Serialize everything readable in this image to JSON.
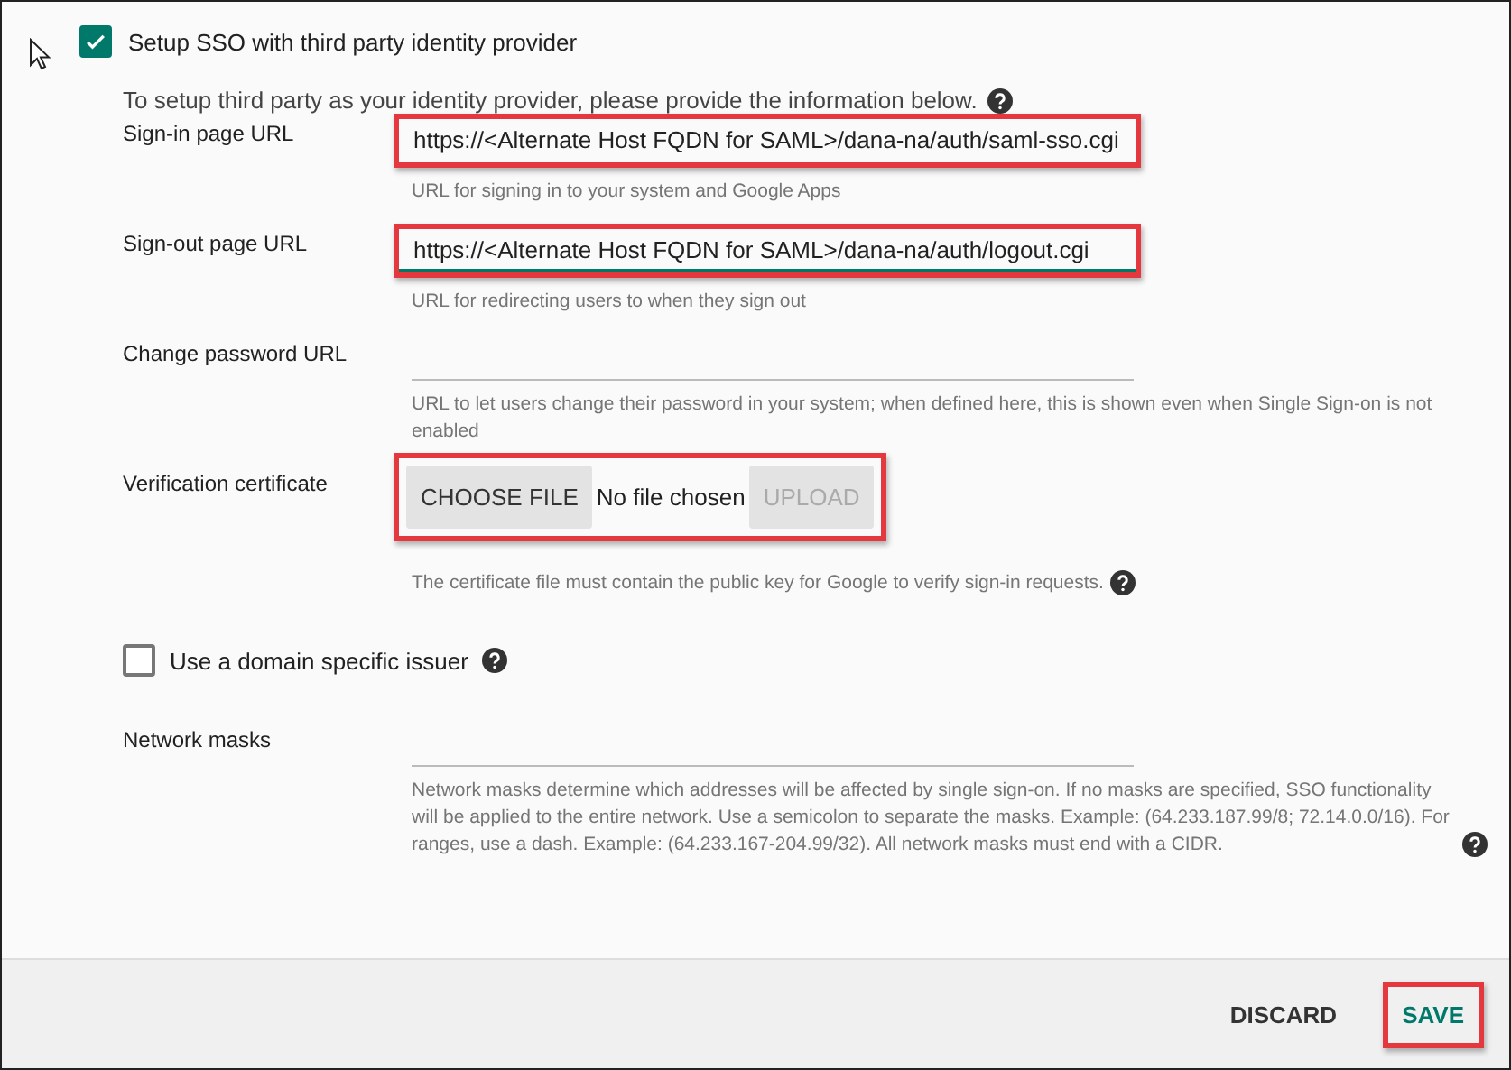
{
  "sso": {
    "label": "Setup SSO with third party identity provider",
    "checked": true
  },
  "intro": {
    "text": "To setup third party as your identity provider, please provide the information below.",
    "help": true
  },
  "rows": [
    {
      "kind": "text",
      "label": "Sign-in page URL",
      "value": "https://<Alternate Host FQDN for SAML>/dana-na/auth/saml-sso.cgi",
      "hint": "URL for signing in to your system and Google Apps",
      "highlighted": true,
      "focused": false
    },
    {
      "kind": "text",
      "label": "Sign-out page URL",
      "value": "https://<Alternate Host FQDN for SAML>/dana-na/auth/logout.cgi",
      "hint": "URL for redirecting users to when they sign out",
      "highlighted": true,
      "focused": true
    },
    {
      "kind": "text",
      "label": "Change password URL",
      "hint": "URL to let users change their password in your system; when defined here, this is shown even when Single Sign-on is not enabled",
      "highlighted": false,
      "focused": false
    },
    {
      "kind": "file",
      "label": "Verification certificate",
      "choose": "CHOOSE FILE",
      "status": "No file chosen",
      "upload": "UPLOAD",
      "upload_disabled": true,
      "hint": "The certificate file must contain the public key for Google to verify sign-in requests.",
      "highlighted": true,
      "help": true
    },
    {
      "kind": "checkbox",
      "label": "Use a domain specific issuer",
      "checked": false,
      "help": true
    },
    {
      "kind": "text",
      "label": "Network masks",
      "hint": "Network masks determine which addresses will be affected by single sign-on. If no masks are specified, SSO functionality will be applied to the entire network. Use a semicolon to separate the masks. Example: (64.233.187.99/8; 72.14.0.0/16). For ranges, use a dash. Example: (64.233.167-204.99/32). All network masks must end with a CIDR.",
      "highlighted": false,
      "focused": false,
      "help": true
    }
  ],
  "buttons": [
    {
      "label": "DISCARD",
      "primary": false,
      "highlighted": false
    },
    {
      "label": "SAVE",
      "primary": true,
      "highlighted": true
    }
  ]
}
